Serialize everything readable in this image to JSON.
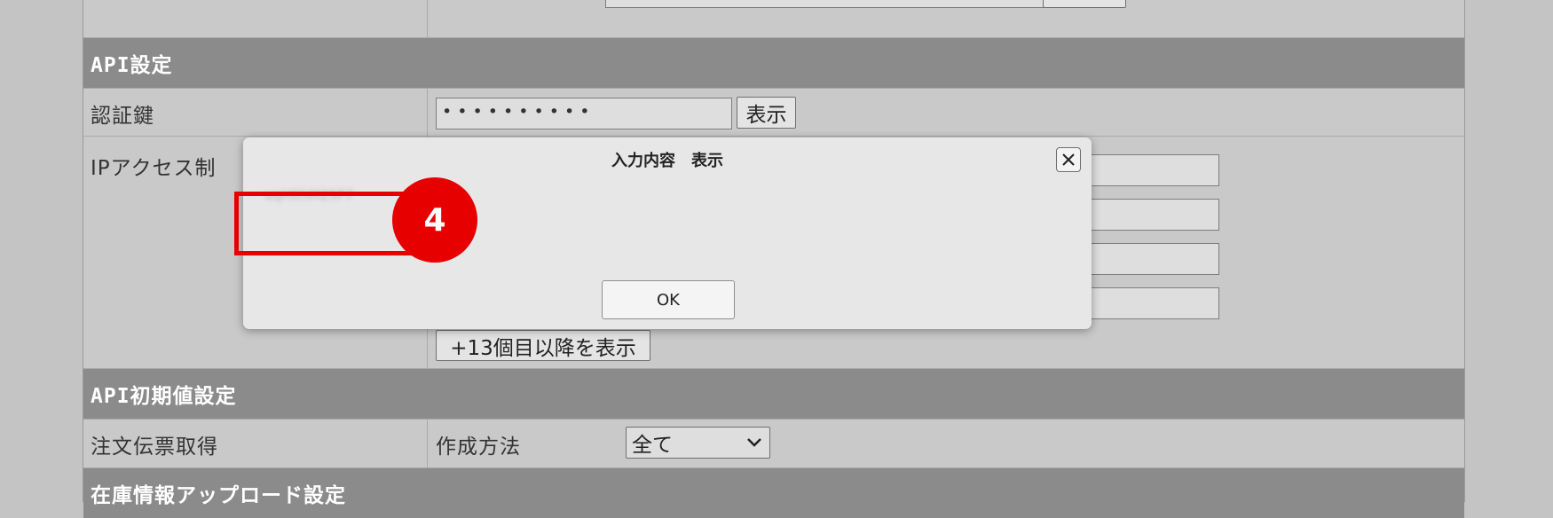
{
  "sections": {
    "api_settings": "API設定",
    "api_initial": "API初期値設定",
    "inventory_upload": "在庫情報アップロード設定"
  },
  "rows": {
    "auth_key_label": "認証鍵",
    "auth_key_value": "• • • • • • • • • •",
    "show_button": "表示",
    "ip_access_label": "IPアクセス制",
    "show_more_button": "+13個目以降を表示",
    "order_fetch_label": "注文伝票取得",
    "create_method_label": "作成方法",
    "create_method_value": "全て"
  },
  "dialog": {
    "title": "入力内容　表示",
    "revealed_value": "uqHKhM25P7",
    "ok_label": "OK",
    "close_icon": "close-icon"
  },
  "annotation": {
    "step_number": "4",
    "color": "#e60000"
  }
}
